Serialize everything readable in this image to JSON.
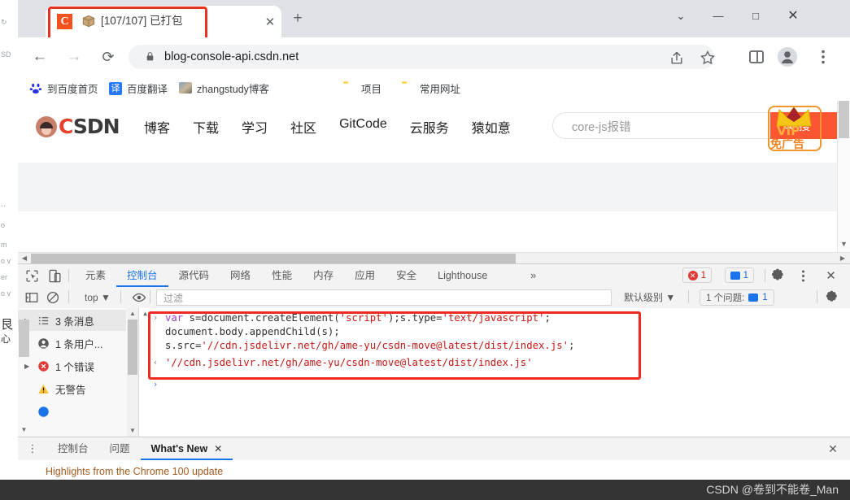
{
  "browser": {
    "tab": {
      "favicon_letter": "C",
      "icon": "package-icon",
      "title": "[107/107] 已打包",
      "close_label": "✕"
    },
    "new_tab_label": "+",
    "window_controls": {
      "tab_search": "⌄",
      "minimize": "—",
      "maximize": "□",
      "close": "✕"
    },
    "nav": {
      "back": "←",
      "forward": "→",
      "reload": "⟳"
    },
    "omnibox": {
      "lock_icon": "lock-icon",
      "url": "blog-console-api.csdn.net",
      "share_icon": "share-icon",
      "star_icon": "star-icon"
    },
    "toolbar_icons": {
      "side_panel": "side-panel-icon",
      "profile": "profile-avatar-icon",
      "menu": "three-dot-menu-icon"
    },
    "bookmarks": [
      {
        "label": "到百度首页",
        "icon": "baidu-icon"
      },
      {
        "label": "百度翻译",
        "icon": "translate-icon"
      },
      {
        "label": "zhangstudy博客",
        "icon": "photo-icon"
      },
      {
        "label": "项目",
        "icon": "folder-icon"
      },
      {
        "label": "常用网址",
        "icon": "folder-icon"
      }
    ]
  },
  "page": {
    "brand": "CSDN",
    "brand_first_letter": "C",
    "nav": [
      "博客",
      "下载",
      "学习",
      "社区",
      "GitCode",
      "云服务",
      "猿如意"
    ],
    "search": {
      "value": "core-js报错",
      "button_label": "搜",
      "search_icon": "magnifier-icon"
    },
    "vip_badge": {
      "crown_icon": "crown-icon",
      "vip_label": "VIP",
      "sub_label": "免广告"
    }
  },
  "devtools": {
    "left_icons": {
      "inspect": "inspect-element-icon",
      "device": "device-toolbar-icon"
    },
    "tabs": [
      {
        "label": "元素",
        "active": false
      },
      {
        "label": "控制台",
        "active": true
      },
      {
        "label": "源代码",
        "active": false
      },
      {
        "label": "网络",
        "active": false
      },
      {
        "label": "性能",
        "active": false
      },
      {
        "label": "内存",
        "active": false
      },
      {
        "label": "应用",
        "active": false
      },
      {
        "label": "安全",
        "active": false
      },
      {
        "label": "Lighthouse",
        "active": false
      }
    ],
    "more_tabs": "»",
    "error_badge": "1",
    "message_badge": "1",
    "right_icons": {
      "settings": "gear-icon",
      "kebab": "three-dot-menu-icon",
      "close": "close-icon"
    },
    "console_filter": {
      "sidebar_toggle_icon": "show-console-sidebar-icon",
      "clear_icon": "clear-console-icon",
      "context": "top",
      "context_caret": "▼",
      "eye_icon": "live-expression-eye-icon",
      "filter_placeholder": "过滤",
      "levels": "默认级别",
      "levels_caret": "▼",
      "issues_label": "1 个问题:",
      "issues_icon": "message-icon",
      "issues_count": "1",
      "settings_icon": "gear-icon"
    },
    "sidebar": [
      {
        "label": "3 条消息",
        "icon": "list-icon",
        "selected": true
      },
      {
        "label": "1 条用户...",
        "icon": "user-icon",
        "selected": false
      },
      {
        "label": "1 个错误",
        "icon": "error-icon",
        "selected": false
      },
      {
        "label": "无警告",
        "icon": "warning-icon",
        "selected": false
      }
    ],
    "console": {
      "input_chevron": "›",
      "output_chevron": "‹",
      "prompt_chevron": "›",
      "line1_kw": "var",
      "line1_a": " s=document.createElement(",
      "line1_s1": "'script'",
      "line1_b": ");s.type=",
      "line1_s2": "'text/javascript'",
      "line1_c": ";",
      "line2": "document.body.appendChild(s);",
      "line3_a": "s.src=",
      "line3_s": "'//cdn.jsdelivr.net/gh/ame-yu/csdn-move@latest/dist/index.js'",
      "line3_b": ";",
      "output": "'//cdn.jsdelivr.net/gh/ame-yu/csdn-move@latest/dist/index.js'"
    },
    "drawer": {
      "kebab_icon": "three-dot-menu-icon",
      "tabs": [
        {
          "label": "控制台",
          "active": false,
          "closable": false
        },
        {
          "label": "问题",
          "active": false,
          "closable": false
        },
        {
          "label": "What's New",
          "active": true,
          "closable": true,
          "close_label": "✕"
        }
      ],
      "close_icon": "close-icon",
      "headline": "Highlights from the Chrome 100 update"
    }
  },
  "watermark": "CSDN @卷到不能卷_Man",
  "colors": {
    "accent_blue": "#1a73e8",
    "error_red": "#e53935",
    "csdn_orange": "#fc5531",
    "highlight_box": "#ee2a21",
    "vip_gold": "#fbb040"
  }
}
